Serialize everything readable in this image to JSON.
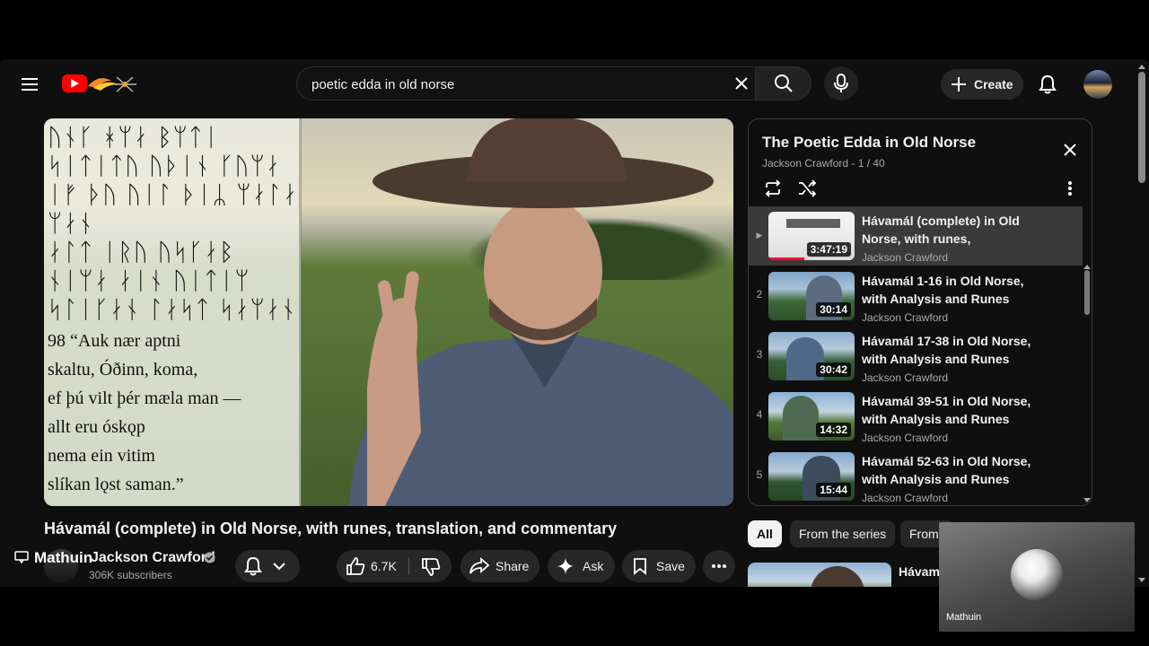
{
  "header": {
    "search_value": "poetic edda in old norse",
    "create_label": "Create"
  },
  "video": {
    "title": "Hávamál (complete) in Old Norse, with runes, translation, and commentary",
    "runes": [
      "ᚢᚾᚴ ᚼᛘᛅ ᛒᛘᛏᛁ",
      "ᛋᛁᛏᛁᛏᚢ ᚢᚦᛁᚾ ᚴᚢᛘᛅ",
      "ᛁᚠ ᚦᚢ ᚢᛁᛚ ᚦᛁᛦ ᛘᛅᛚᛅ ᛘᛅᚾ",
      "ᛅᛚᛏ ᛁᚱᚢ ᚢᛋᚴᛅᛒ",
      "ᚾᛁᛘᛅ ᛅᛁᚾ ᚢᛁᛏᛁᛘ",
      "ᛋᛚᛁᚴᛅᚾ ᛚᛅᛋᛏ ᛋᛅᛘᛅᚾ"
    ],
    "verse": [
      "98 “Auk nær aptni",
      "skaltu, Óðinn, koma,",
      "ef þú vilt þér mæla man —",
      "allt eru óskǫp",
      "nema ein vitim",
      "slíkan lǫst saman.”"
    ]
  },
  "channel": {
    "name": "Jackson Crawford",
    "subscribers": "306K subscribers",
    "overlay_name": "Mathuin"
  },
  "actions": {
    "likes": "6.7K",
    "share": "Share",
    "ask": "Ask",
    "save": "Save"
  },
  "playlist": {
    "title": "The Poetic Edda in Old Norse",
    "meta": "Jackson Crawford - 1 / 40",
    "items": [
      {
        "index": "▶",
        "title": "Hávamál (complete) in Old Norse, with runes, translation,…",
        "channel": "Jackson Crawford",
        "duration": "3:47:19"
      },
      {
        "index": "2",
        "title": "Hávamál 1-16 in Old Norse, with Analysis and Runes",
        "channel": "Jackson Crawford",
        "duration": "30:14"
      },
      {
        "index": "3",
        "title": "Hávamál 17-38 in Old Norse, with Analysis and Runes",
        "channel": "Jackson Crawford",
        "duration": "30:42"
      },
      {
        "index": "4",
        "title": "Hávamál 39-51 in Old Norse, with Analysis and Runes",
        "channel": "Jackson Crawford",
        "duration": "14:32"
      },
      {
        "index": "5",
        "title": "Hávamál 52-63 in Old Norse, with Analysis and Runes",
        "channel": "Jackson Crawford",
        "duration": "15:44"
      }
    ]
  },
  "chips": {
    "all": "All",
    "series": "From the series",
    "from": "From"
  },
  "recommended": {
    "title_fragment": "Hávama"
  },
  "pip": {
    "name": "Mathuin"
  }
}
